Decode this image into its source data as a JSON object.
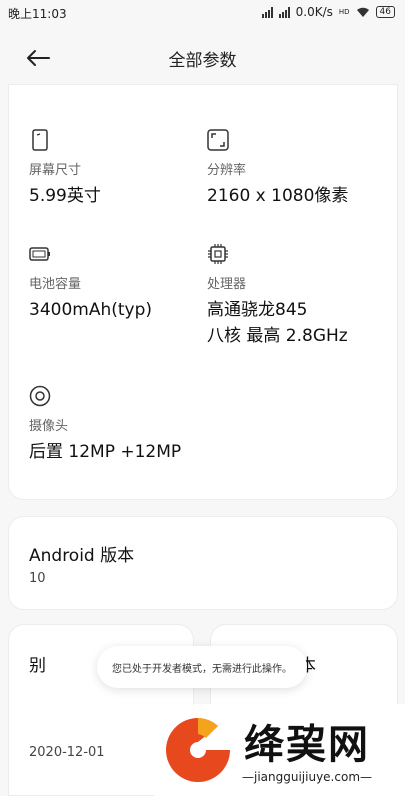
{
  "status_bar": {
    "time": "晚上11:03",
    "net_speed": "0.0K/s",
    "hd_badge": "HD",
    "battery": "46"
  },
  "header": {
    "title": "全部参数",
    "back_icon": "arrow-left-icon"
  },
  "specs": [
    {
      "icon": "screen-icon",
      "label": "屏幕尺寸",
      "value": "5.99英寸"
    },
    {
      "icon": "resolution-icon",
      "label": "分辨率",
      "value": "2160 x 1080像素"
    },
    {
      "icon": "battery-icon",
      "label": "电池容量",
      "value": "3400mAh(typ)"
    },
    {
      "icon": "cpu-icon",
      "label": "处理器",
      "value": "高通骁龙845",
      "value2": "八核 最高 2.8GHz"
    },
    {
      "icon": "camera-icon",
      "label": "摄像头",
      "value": "后置 12MP +12MP"
    }
  ],
  "android": {
    "title": "Android 版本",
    "value": "10"
  },
  "bottom_left": {
    "label_partial": "别",
    "date": "2020-12-01"
  },
  "bottom_right": {
    "label_partial": "本"
  },
  "toast": {
    "message": "您已处于开发者模式，无需进行此操作。"
  },
  "watermark": {
    "title": "绛巭网",
    "url": "—jiangguijiuye.com—"
  }
}
